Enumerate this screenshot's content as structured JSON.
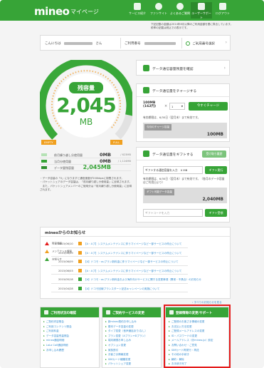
{
  "header": {
    "logo": "mineo",
    "subtitle": "マイページ",
    "nav": [
      {
        "label": "サービス紹介",
        "icon": "service-icon"
      },
      {
        "label": "ファンサイト",
        "icon": "fansite-icon"
      },
      {
        "label": "よくあるご質問",
        "icon": "faq-icon"
      },
      {
        "label": "ユーザーサポート",
        "icon": "support-icon"
      },
      {
        "label": "ログアウト",
        "icon": "logout-icon"
      }
    ]
  },
  "notes": [
    "下記記載の金額は2014年8月以降のご利用金額を基に算出しています。",
    "税率の記載は税込での表示です。"
  ],
  "user": {
    "greeting": "こんにちは",
    "suffix": "さん",
    "plan_label": "ご利用番号",
    "plan_value": "",
    "link": "ご利用番号選択"
  },
  "gauge": {
    "label": "残容量",
    "value": "2,045",
    "unit": "MB",
    "remaining_fraction": 0.88,
    "empty": "EMPTY",
    "full": "FULL"
  },
  "legend": [
    {
      "label": "前月繰り越し分使用量",
      "value": "0MB",
      "max": "/ 623MB",
      "color": "#b5e2b5"
    },
    {
      "label": "当月分使用量",
      "value": "0MB",
      "max": "/ 1,124MB",
      "color": "#37a437"
    },
    {
      "label": "データ量残容量",
      "value": "2,045MB",
      "max": "",
      "color": "#2f8f2f"
    }
  ],
  "legend_notes": [
    "・データ容量の「0」になりますと通信速度が200kbpsに制限されます。",
    "・パケットシェアのデータ容量は、「前月繰り越し分使用量」に反映されます。",
    "　また、パケットシェアメンバーのご使用分は「前月繰り越し分使用量」に反映されます。"
  ],
  "panel_usage": {
    "title": "データ通信容量残量を確認"
  },
  "panel_charge": {
    "title": "データ通信量をチャージする",
    "plan": "100MB",
    "price": "(162円)",
    "qty": "1",
    "button": "今すぐチャージ",
    "note": "有効期限は、6/30日（翌月末）まで有効です。",
    "box_head": "今月のチャージ容量",
    "box_value": "100MB"
  },
  "panel_gift": {
    "title": "データ通信量をギフトする",
    "history": "受け取り履歴",
    "input_label": "ギフトする通信容量を入力",
    "input_value": "0",
    "input_unit": "MB",
    "button": "ギフト実行",
    "note": "有効期限は、6/30日（翌月末）まで有効です。（各月のデータ容量はご利用日より）",
    "box_head": "ギフト可能データ容量",
    "box_value": "2,040MB",
    "code_placeholder": "ギフトコードを入力",
    "code_button": "ギフト受領"
  },
  "news": {
    "title": "mineoからのお知らせ",
    "legend": [
      {
        "label": "障害情報",
        "color": "#e41b1b"
      },
      {
        "label": "メンテナンス情報",
        "color": "#f0a020"
      },
      {
        "label": "お知らせ",
        "color": "#37a437"
      }
    ],
    "rows": [
      {
        "date": "2015/06/10",
        "text": "【A・Aプ】システムメンテナンスに伴うマイページなど一部サービスの停止について",
        "color": "#f0a020"
      },
      {
        "date": "2015/06/09",
        "text": "【A・Aプ】システムメンテナンスに伴うマイページなど一部サービスの停止について",
        "color": "#f0a020"
      },
      {
        "date": "2015/06/09",
        "text": "【A】ドコモ・auプラン新料金に伴うマイページなど一部サービスの停止について",
        "color": "#f0a020"
      },
      {
        "date": "2015/06/03",
        "text": "【A・Aプ】システムメンテナンスに伴うマイページなど一部サービスの停止について",
        "color": "#f0a020"
      },
      {
        "date": "2015/05/18",
        "text": "【A】ドコモ・auプラン新料金および海外向けサービスに関する変更事項（異常・不具合）のお知らせ",
        "color": "#37a437"
      },
      {
        "date": "2015/04/28",
        "text": "【A】ドコモ回線プランスタート記念キャンペーンの実施について",
        "color": "#37a437"
      }
    ],
    "more": "すべてのお知らせを見る"
  },
  "boxes": [
    {
      "title": "ご利用状況の確認",
      "items": [
        "ご契約内容照会",
        "ご利用コンテンツ照会",
        "ご利用料金",
        "データ容量残量照会",
        "mineo通話明細",
        "LaLa Call通話明細",
        "お申し込み履歴"
      ]
    },
    {
      "title": "ご契約サービスの変更",
      "items": [
        "新mineo契約お申し込み",
        "基本データ容量の変更",
        "タイプ変更（音声通話あり/なし）",
        "プラン変更（Aプラン↔Dプラン）",
        "端末補償お申し込み",
        "オプション変更",
        "家族割引",
        "お客さま情報変更",
        "SIMカード種類変更",
        "パケットシェア変更"
      ]
    },
    {
      "title": "登録情報の変更/サポート",
      "items": [
        "ご登録のお客さま情報の変更",
        "お支払い方法変更",
        "ご登録メールアドレスの変更",
        "ID・パスワードの変更",
        "メールアドレス（@mineo.jp）設定",
        "お問い合わせ・ご意見",
        "SIMカード再発行・再送",
        "その他の手続き",
        "解約・解除",
        "お手続き完了"
      ]
    }
  ]
}
